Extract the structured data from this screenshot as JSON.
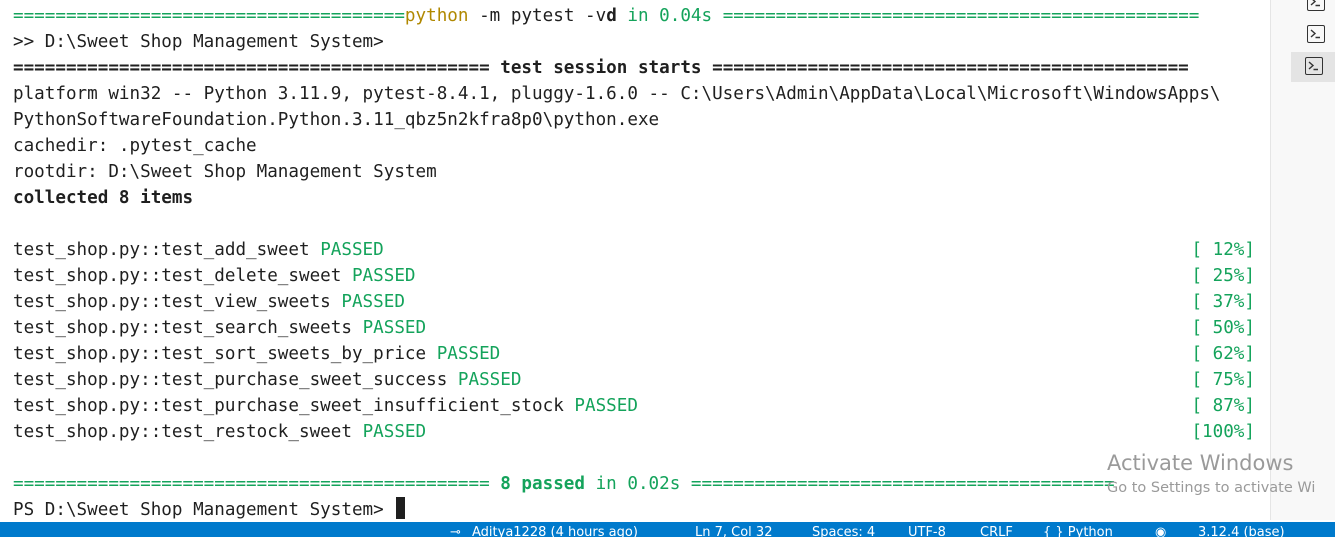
{
  "terminal": {
    "header": {
      "left_rule": "=====================================",
      "cmd_python": "python",
      "cmd_args": " -m pytest -v",
      "cmd_d": "d",
      "cmd_in": " in ",
      "cmd_time": "0.04s",
      "right_rule": " ============================================="
    },
    "prompt_1": ">> D:\\Sweet Shop Management System>",
    "session": {
      "left_rule": "============================================= ",
      "label": "test session starts",
      "right_rule": " ============================================="
    },
    "platform_line_1": "platform win32 -- Python 3.11.9, pytest-8.4.1, pluggy-1.6.0 -- C:\\Users\\Admin\\AppData\\Local\\Microsoft\\WindowsApps\\",
    "platform_line_2": "PythonSoftwareFoundation.Python.3.11_qbz5n2kfra8p0\\python.exe",
    "cachedir": "cachedir: .pytest_cache",
    "rootdir": "rootdir: D:\\Sweet Shop Management System",
    "collected": "collected 8 items",
    "status_word": "PASSED",
    "tests": [
      {
        "name": "test_shop.py::test_add_sweet",
        "progress": "[ 12%]"
      },
      {
        "name": "test_shop.py::test_delete_sweet",
        "progress": "[ 25%]"
      },
      {
        "name": "test_shop.py::test_view_sweets",
        "progress": "[ 37%]"
      },
      {
        "name": "test_shop.py::test_search_sweets",
        "progress": "[ 50%]"
      },
      {
        "name": "test_shop.py::test_sort_sweets_by_price",
        "progress": "[ 62%]"
      },
      {
        "name": "test_shop.py::test_purchase_sweet_success",
        "progress": "[ 75%]"
      },
      {
        "name": "test_shop.py::test_purchase_sweet_insufficient_stock",
        "progress": "[ 87%]"
      },
      {
        "name": "test_shop.py::test_restock_sweet",
        "progress": "[100%]"
      }
    ],
    "summary": {
      "left_rule": "============================================= ",
      "passed": "8 passed",
      "in": " in ",
      "time": "0.02s",
      "right_rule": " ========================================"
    },
    "prompt_2": "PS D:\\Sweet Shop Management System> "
  },
  "watermark": {
    "title": "Activate Windows",
    "subtitle": "Go to Settings to activate Wi"
  },
  "status_bar": {
    "git": "Aditya1228 (4 hours ago)",
    "position": "Ln 7, Col 32",
    "spaces": "Spaces: 4",
    "encoding": "UTF-8",
    "eol": "CRLF",
    "language": "{ } Python",
    "interpreter": "3.12.4 (base)"
  },
  "colors": {
    "green": "#14a35b",
    "yellow": "#b08800",
    "status_bar": "#007acc"
  },
  "icons": [
    "terminal-icon",
    "git-commit-icon",
    "copilot-icon"
  ]
}
